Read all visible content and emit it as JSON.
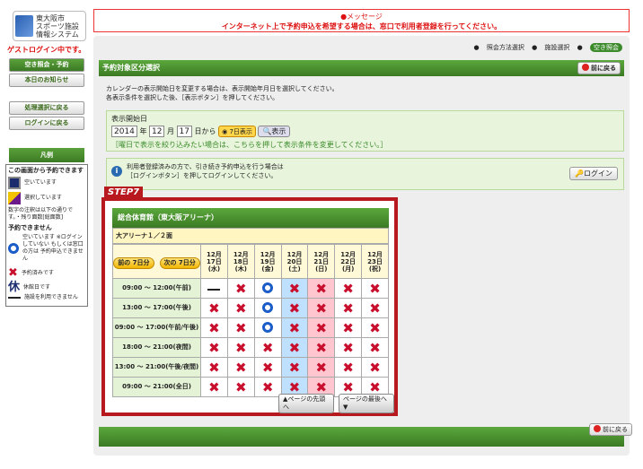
{
  "logo": {
    "lines": [
      "東大阪市",
      "スポーツ施設",
      "情報システム"
    ]
  },
  "message": {
    "title": "●メッセージ",
    "text": "インターネット上で予約申込を希望する場合は、窓口で利用者登録を行ってください。"
  },
  "guest": "ゲストログイン中です。",
  "sidebar": {
    "items": [
      {
        "label": "空き照会・予約",
        "active": true
      },
      {
        "label": "本日のお知らせ"
      },
      {
        "label": "処理選択に戻る"
      },
      {
        "label": "ログインに戻る"
      }
    ]
  },
  "legend": {
    "title": "凡例",
    "subtitle": "この画面から予約できます",
    "empty": "空いています",
    "selected": "選択しています",
    "note": "数字の注釈は以下の通りです。・残り面数[総面数]",
    "unavailable": "予約できません",
    "login_note": "空いています ※ログインしていない もしくは窓口の方は 予約申込できません",
    "reserved": "予約済みです",
    "holiday_icon": "休",
    "holiday": "休館日です",
    "none": "施設を利用できません"
  },
  "radios": [
    "照会方法選択",
    "施設選択",
    "空き照会"
  ],
  "section": {
    "title": "予約対象区分選択",
    "back": "前に戻る"
  },
  "desc": [
    "カレンダーの表示開始日を変更する場合は、表示開始年月日を選択してください。",
    "各表示条件を選択した後、［表示ボタン］を押してください。"
  ],
  "date": {
    "label": "表示開始日",
    "year": "2014",
    "month": "12",
    "day": "17",
    "year_unit": "年",
    "month_unit": "月",
    "day_unit": "日から",
    "days_btn": "7日表示",
    "show_btn": "表示",
    "hint": "［曜日で表示を絞り込みたい場合は、こちらを押して表示条件を変更してください。］"
  },
  "info": {
    "line1": "利用者登録済みの方で、引き続き予約申込を行う場合は",
    "line2": "［ログインボタン］を押してログインしてください。",
    "login": "ログイン"
  },
  "step": "STEP7",
  "facility": "総合体育館（東大阪アリーナ）",
  "arena": "大アリーナ１／２面",
  "nav": {
    "prev": "前の 7日分",
    "next": "次の 7日分"
  },
  "days": [
    {
      "m": "12月",
      "d": "17日",
      "w": "(水)"
    },
    {
      "m": "12月",
      "d": "18日",
      "w": "(木)"
    },
    {
      "m": "12月",
      "d": "19日",
      "w": "(金)"
    },
    {
      "m": "12月",
      "d": "20日",
      "w": "(土)"
    },
    {
      "m": "12月",
      "d": "21日",
      "w": "(日)"
    },
    {
      "m": "12月",
      "d": "22日",
      "w": "(月)"
    },
    {
      "m": "12月",
      "d": "23日",
      "w": "(祝)"
    }
  ],
  "slots": [
    {
      "label": "09:00 ～ 12:00(午前)",
      "cells": [
        "dash",
        "x",
        "o",
        "x",
        "x",
        "x",
        "x"
      ]
    },
    {
      "label": "13:00 ～ 17:00(午後)",
      "cells": [
        "x",
        "x",
        "o",
        "x",
        "x",
        "x",
        "x"
      ]
    },
    {
      "label": "09:00 ～ 17:00(午前/午後)",
      "cells": [
        "x",
        "x",
        "o",
        "x",
        "x",
        "x",
        "x"
      ]
    },
    {
      "label": "18:00 ～ 21:00(夜間)",
      "cells": [
        "x",
        "x",
        "x",
        "x",
        "x",
        "x",
        "x"
      ]
    },
    {
      "label": "13:00 ～ 21:00(午後/夜間)",
      "cells": [
        "x",
        "x",
        "x",
        "x",
        "x",
        "x",
        "x"
      ]
    },
    {
      "label": "09:00 ～ 21:00(全日)",
      "cells": [
        "x",
        "x",
        "x",
        "x",
        "x",
        "x",
        "x"
      ]
    }
  ],
  "page": {
    "top": "▲ページの先頭へ",
    "bottom": "ページの最後へ▼"
  },
  "footer_back": "前に戻る"
}
